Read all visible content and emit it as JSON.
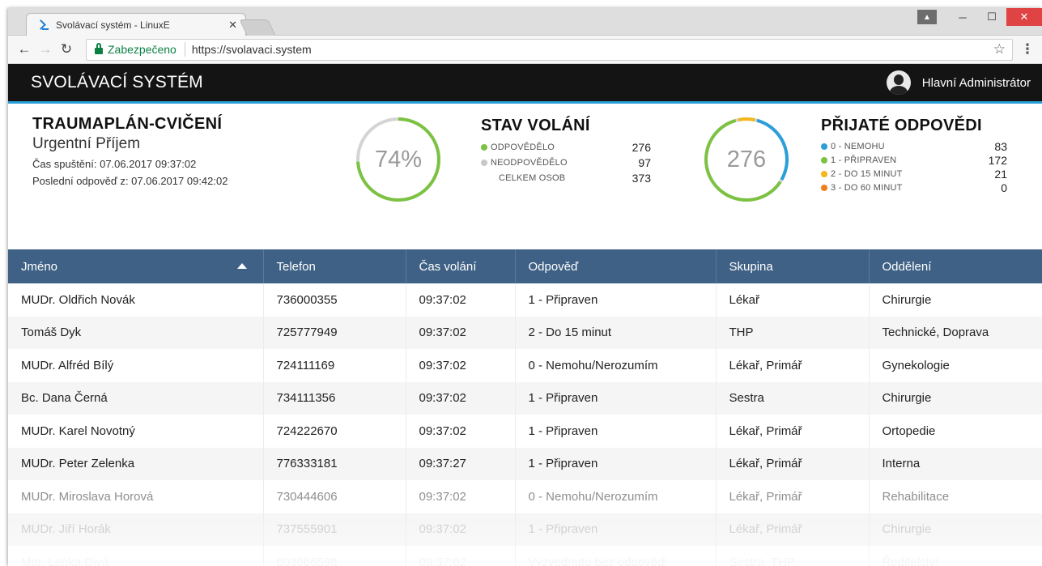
{
  "browser": {
    "tab_title": "Svolávací systém - LinuxE",
    "tab_close": "✕",
    "secure_label": "Zabezpečeno",
    "url": "https://svolavaci.system"
  },
  "app": {
    "title": "SVOLÁVACÍ SYSTÉM",
    "user": "Hlavní Administrátor"
  },
  "mission": {
    "title": "TRAUMAPLÁN-CVIČENÍ",
    "subtitle": "Urgentní Příjem",
    "started": "Čas spuštění: 07.06.2017 09:37:02",
    "last_answer": "Poslední odpověď z: 07.06.2017 09:42:02"
  },
  "progress": {
    "label": "74%",
    "value": 0.74
  },
  "call_status": {
    "title": "STAV VOLÁNÍ",
    "rows": [
      {
        "label": "ODPOVĚDĚLO",
        "value": "276",
        "color": "#7cc242"
      },
      {
        "label": "NEODPOVĚDĚLO",
        "value": "97",
        "color": "#c8c8c8"
      },
      {
        "label": "CELKEM OSOB",
        "value": "373",
        "color": ""
      }
    ]
  },
  "answers_ring": {
    "label": "276",
    "segments": [
      {
        "value": 83,
        "color": "#2a9fd8"
      },
      {
        "value": 172,
        "color": "#7cc242"
      },
      {
        "value": 21,
        "color": "#f3b71b"
      },
      {
        "value": 0,
        "color": "#f07f1a"
      }
    ]
  },
  "answers": {
    "title": "PŘIJATÉ ODPOVĚDI",
    "rows": [
      {
        "label": "0 - NEMOHU",
        "value": "83",
        "color": "#2a9fd8"
      },
      {
        "label": "1 - PŘIPRAVEN",
        "value": "172",
        "color": "#7cc242"
      },
      {
        "label": "2 - DO 15 MINUT",
        "value": "21",
        "color": "#f3b71b"
      },
      {
        "label": "3 - DO 60 MINUT",
        "value": "0",
        "color": "#f07f1a"
      }
    ]
  },
  "table": {
    "columns": [
      "Jméno",
      "Telefon",
      "Čas volání",
      "Odpověď",
      "Skupina",
      "Oddělení"
    ],
    "rows": [
      [
        "MUDr. Oldřich Novák",
        "736000355",
        "09:37:02",
        "1 - Připraven",
        "Lékař",
        "Chirurgie"
      ],
      [
        "Tomáš Dyk",
        "725777949",
        "09:37:02",
        "2 - Do 15 minut",
        "THP",
        "Technické, Doprava"
      ],
      [
        "MUDr. Alfréd Bílý",
        "724111169",
        "09:37:02",
        "0 - Nemohu/Nerozumím",
        "Lékař, Primář",
        "Gynekologie"
      ],
      [
        "Bc. Dana Černá",
        "734111356",
        "09:37:02",
        "1 - Připraven",
        "Sestra",
        "Chirurgie"
      ],
      [
        "MUDr. Karel Novotný",
        "724222670",
        "09:37:02",
        "1 - Připraven",
        "Lékař, Primář",
        "Ortopedie"
      ],
      [
        "MUDr. Peter Zelenka",
        "776333181",
        "09:37:27",
        "1 - Připraven",
        "Lékař, Primář",
        "Interna"
      ],
      [
        "MUDr. Miroslava Horová",
        "730444606",
        "09:37:02",
        "0 - Nemohu/Nerozumím",
        "Lékař, Primář",
        "Rehabilitace"
      ],
      [
        "MUDr. Jiří Horák",
        "737555901",
        "09:37:02",
        "1 - Připraven",
        "Lékař, Primář",
        "Chirurgie"
      ],
      [
        "Mgr. Lenka Divá",
        "603666598",
        "09:37:02",
        "Vyzvednuto bez odpovědi",
        "Sestra, THP",
        "Ředitelství"
      ]
    ]
  }
}
